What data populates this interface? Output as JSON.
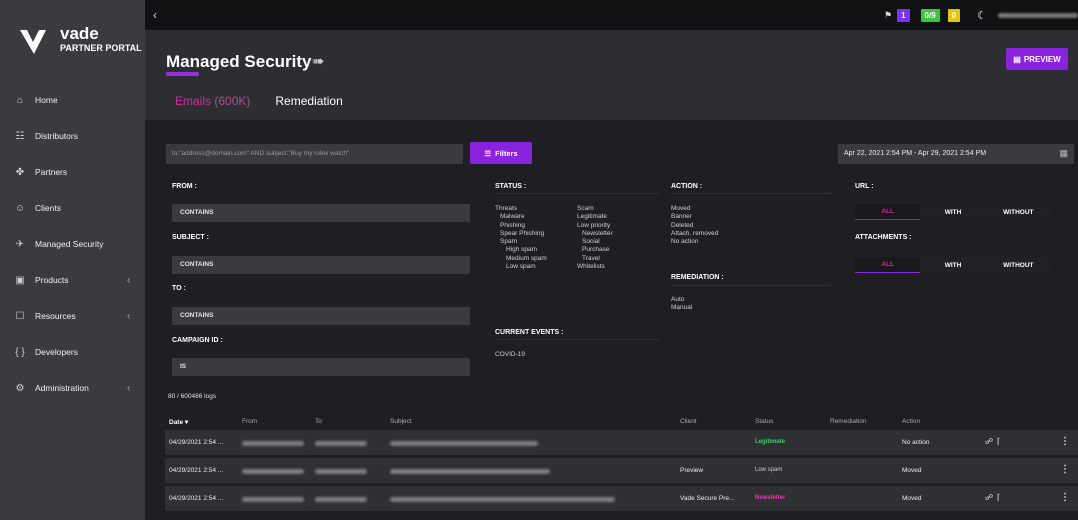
{
  "brand": {
    "name": "vade",
    "sub": "PARTNER PORTAL"
  },
  "sidebar": {
    "items": [
      {
        "label": "Home",
        "icon": "home-icon",
        "glyph": "⌂"
      },
      {
        "label": "Distributors",
        "icon": "distributors-icon",
        "glyph": "☷"
      },
      {
        "label": "Partners",
        "icon": "partners-icon",
        "glyph": "✤"
      },
      {
        "label": "Clients",
        "icon": "clients-icon",
        "glyph": "☺"
      },
      {
        "label": "Managed Security",
        "icon": "rocket-icon",
        "glyph": "✈"
      },
      {
        "label": "Products",
        "icon": "products-icon",
        "glyph": "▣",
        "chevron": "‹"
      },
      {
        "label": "Resources",
        "icon": "resources-icon",
        "glyph": "☐",
        "chevron": "‹"
      },
      {
        "label": "Developers",
        "icon": "code-icon",
        "glyph": "{ }"
      },
      {
        "label": "Administration",
        "icon": "admin-icon",
        "glyph": "⚙",
        "chevron": "‹"
      }
    ]
  },
  "topbar": {
    "back": "‹",
    "badges": [
      "1",
      "0/9",
      "0"
    ],
    "colors": {
      "badge1": "#7b2ff7",
      "badge2": "#3cc63c",
      "badge3": "#e6c800"
    }
  },
  "header": {
    "title": "Managed Security",
    "preview": "PREVIEW",
    "tabs": {
      "emails": "Emails",
      "emails_count": "(600K)",
      "remediation": "Remediation"
    }
  },
  "search": {
    "placeholder": "to:\"address@domain.com\" AND subject:\"Buy my rolex watch\"",
    "filters": "Filters"
  },
  "daterange": "Apr 22, 2021 2:54 PM - Apr 29, 2021 2:54 PM",
  "filters": {
    "from": "FROM :",
    "subject": "SUBJECT :",
    "to": "TO :",
    "campaign": "CAMPAIGN ID :",
    "contains": "CONTAINS",
    "is": "IS",
    "status": "STATUS :",
    "status_left": [
      "Threats",
      "Malware",
      "Phishing",
      "Spear Phishing",
      "Spam",
      "High spam",
      "Medium spam",
      "Low spam"
    ],
    "status_right": [
      "Scam",
      "Legitimate",
      "Low priority",
      "Newsletter",
      "Social",
      "Purchase",
      "Travel",
      "Whitelists"
    ],
    "current_events": "CURRENT EVENTS :",
    "covid": "COVID-19",
    "action": "ACTION :",
    "actions": [
      "Moved",
      "Banner",
      "Deleted",
      "Attach. removed",
      "No action"
    ],
    "remediation": "REMEDIATION :",
    "remediations": [
      "Auto",
      "Manual"
    ],
    "url": "URL :",
    "attachments": "ATTACHMENTS :",
    "seg": [
      "ALL",
      "WITH",
      "WITHOUT"
    ]
  },
  "logs": "80 / 600486 logs",
  "table": {
    "headers": {
      "date": "Date",
      "from": "From",
      "to": "To",
      "subject": "Subject",
      "client": "Client",
      "status": "Status",
      "remediation": "Remediation",
      "action": "Action"
    },
    "rows": [
      {
        "date": "04/29/2021 2:54 ...",
        "client": "",
        "status": "Legitimate",
        "status_color": "#37d16a",
        "action": "No action",
        "icons": "∕№"
      },
      {
        "date": "04/29/2021 2:54 ...",
        "client": "Preview",
        "status": "Low spam",
        "status_color": "#c9c9cc",
        "action": "Moved",
        "icons": ""
      },
      {
        "date": "04/29/2021 2:54 ...",
        "client": "Vade Secure Pre...",
        "status": "Newsletter",
        "status_color": "#e23cb4",
        "action": "Moved",
        "icons": "∕№"
      }
    ]
  }
}
